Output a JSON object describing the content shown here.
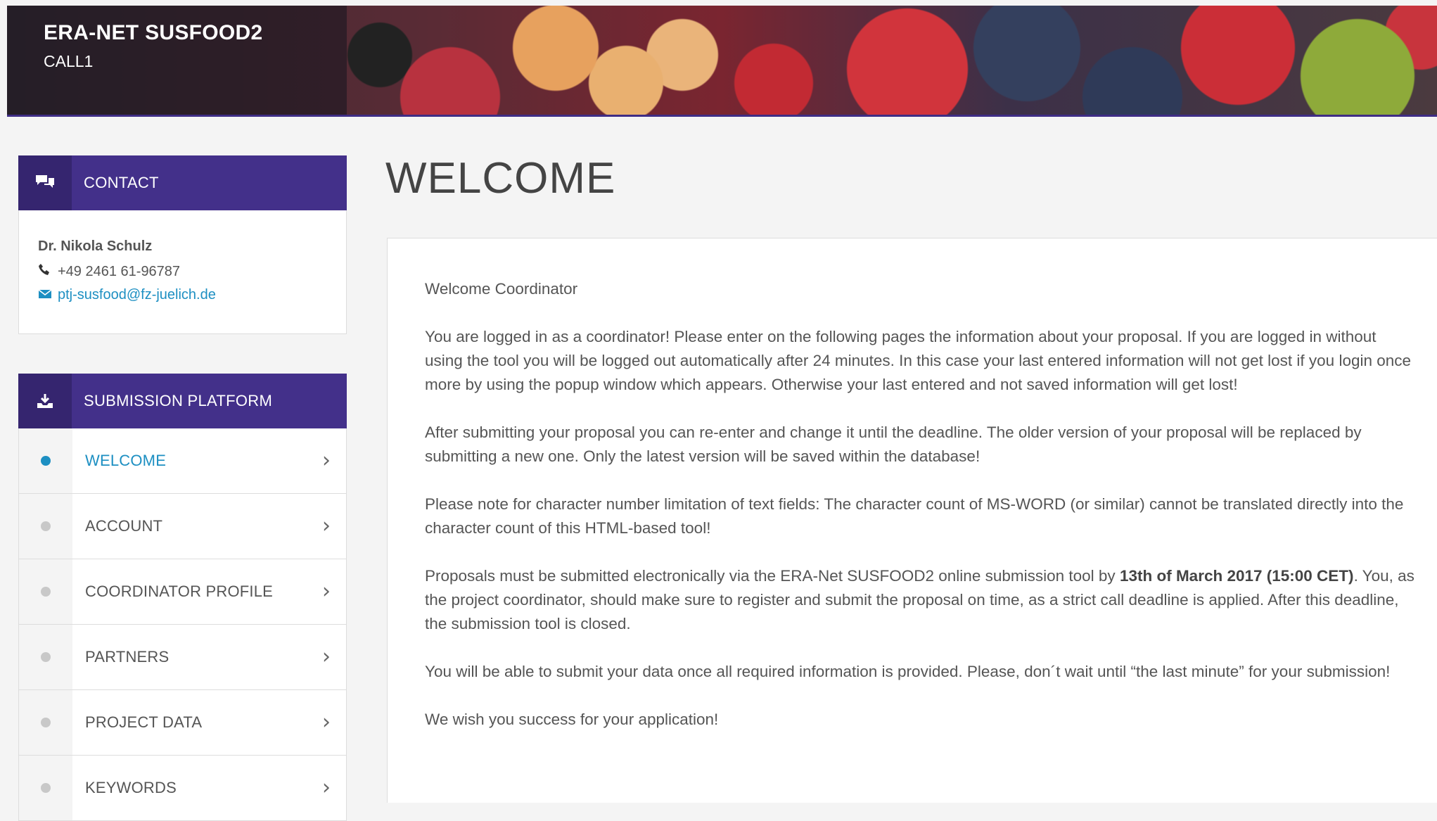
{
  "header": {
    "title": "ERA-NET SUSFOOD2",
    "subtitle": "CALL1"
  },
  "contact": {
    "heading": "CONTACT",
    "name": "Dr. Nikola Schulz",
    "phone": "+49 2461 61-96787",
    "email": "ptj-susfood@fz-juelich.de"
  },
  "submission": {
    "heading": "SUBMISSION PLATFORM",
    "items": [
      {
        "label": "WELCOME",
        "active": true
      },
      {
        "label": "ACCOUNT",
        "active": false
      },
      {
        "label": "COORDINATOR PROFILE",
        "active": false
      },
      {
        "label": "PARTNERS",
        "active": false
      },
      {
        "label": "PROJECT DATA",
        "active": false
      },
      {
        "label": "KEYWORDS",
        "active": false
      }
    ]
  },
  "main": {
    "title": "WELCOME",
    "greeting": "Welcome Coordinator",
    "p1": "You are logged in as a coordinator! Please enter on the following pages the information about your proposal. If you are logged in without using the tool you will be logged out automatically after 24 minutes. In this case your last entered information will not get lost if you login once more by using the popup window which appears. Otherwise your last entered and not saved information will get lost!",
    "p2": "After submitting your proposal you can re-enter and change it until the deadline. The older version of your proposal will be replaced by submitting a new one. Only the latest version will be saved within the database!",
    "p3": "Please note for character number limitation of text fields: The character count of MS-WORD (or similar) cannot be translated directly into the character count of this HTML-based tool!",
    "p4_a": "Proposals must be submitted electronically via the ERA-Net SUSFOOD2 online submission tool by ",
    "p4_bold": "13th of March 2017 (15:00 CET)",
    "p4_b": ". You, as the project coordinator, should make sure to register and submit the proposal on time, as a strict call deadline is applied. After this deadline, the submission tool is closed.",
    "p5": "You will be able to submit your data once all required information is provided. Please, don´t wait until “the last minute” for your submission!",
    "p6": "We wish you success for your application!"
  },
  "colors": {
    "accent": "#43308a",
    "link": "#1d8fc2"
  },
  "icons": {
    "contact": "chat-bubbles-icon",
    "submission": "download-tray-icon",
    "phone": "phone-icon",
    "email": "envelope-icon",
    "chevron": "chevron-right-icon"
  }
}
